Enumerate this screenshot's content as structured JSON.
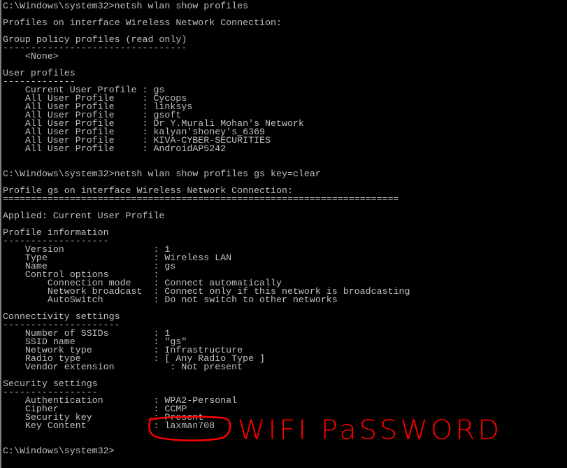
{
  "window": {
    "type": "command-prompt",
    "text_color": "#c0c0c0",
    "background": "#000000"
  },
  "lines": [
    "C:\\Windows\\system32>netsh wlan show profiles",
    "",
    "Profiles on interface Wireless Network Connection:",
    "",
    "Group policy profiles (read only)",
    "---------------------------------",
    "    <None>",
    "",
    "User profiles",
    "-------------",
    "    Current User Profile : gs",
    "    All User Profile     : Cycops",
    "    All User Profile     : linksys",
    "    All User Profile     : gsoft",
    "    All User Profile     : Dr Y.Murali Mohan's Network",
    "    All User Profile     : kalyan'shoney's_6369",
    "    All User Profile     : KIVA-CYBER-SECURITIES",
    "    All User Profile     : AndroidAP5242",
    "",
    "",
    "C:\\Windows\\system32>netsh wlan show profiles gs key=clear",
    "",
    "Profile gs on interface Wireless Network Connection:",
    "=======================================================================",
    "",
    "Applied: Current User Profile",
    "",
    "Profile information",
    "-------------------",
    "    Version                : 1",
    "    Type                   : Wireless LAN",
    "    Name                   : gs",
    "    Control options        :",
    "        Connection mode    : Connect automatically",
    "        Network broadcast  : Connect only if this network is broadcasting",
    "        AutoSwitch         : Do not switch to other networks",
    "",
    "Connectivity settings",
    "---------------------",
    "    Number of SSIDs        : 1",
    "    SSID name              : \"gs\"",
    "    Network type           : Infrastructure",
    "    Radio type             : [ Any Radio Type ]",
    "    Vendor extension          : Not present",
    "",
    "Security settings",
    "-----------------",
    "    Authentication         : WPA2-Personal",
    "    Cipher                 : CCMP",
    "    Security key           : Present",
    "    Key Content            : laxman708",
    "",
    "",
    "C:\\Windows\\system32>"
  ],
  "annotation": {
    "label": "WIFI PaSSWORD",
    "color": "#ff0000",
    "circled_value": "laxman708"
  }
}
